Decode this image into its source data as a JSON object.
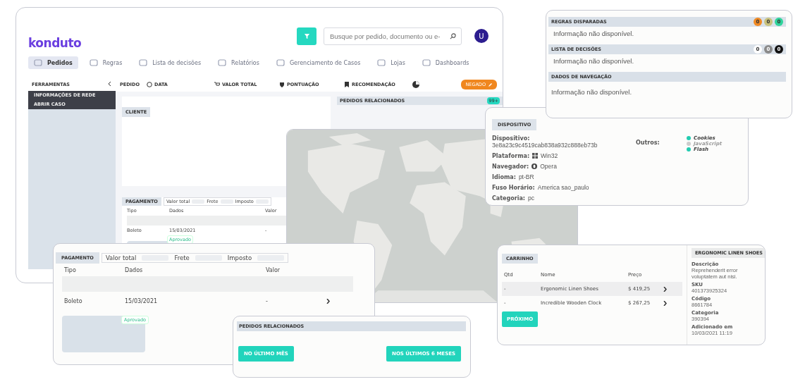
{
  "app": {
    "logo": "konduto",
    "search": {
      "placeholder": "Busque por pedido, documento ou e-"
    },
    "avatar": "U",
    "nav": [
      {
        "label": "Pedidos",
        "selected": true
      },
      {
        "label": "Regras",
        "selected": false
      },
      {
        "label": "Lista de decisões",
        "selected": false
      },
      {
        "label": "Relatórios",
        "selected": false
      },
      {
        "label": "Gerenciamento de Casos",
        "selected": false
      },
      {
        "label": "Lojas",
        "selected": false
      },
      {
        "label": "Dashboards",
        "selected": false
      }
    ],
    "sidebar": {
      "title": "FERRAMENTAS",
      "items": [
        "INFORMAÇÕES DE REDE",
        "ABRIR CASO"
      ]
    },
    "order_header": {
      "title": "PEDIDO",
      "columns": [
        "DATA",
        "VALOR TOTAL",
        "PONTUAÇÃO",
        "RECOMENDAÇÃO"
      ],
      "status": "NEGADO"
    },
    "client": {
      "title": "CLIENTE"
    },
    "related": {
      "title": "PEDIDOS RELACIONADOS",
      "count": "99+"
    },
    "payment": {
      "title": "PAGAMENTO",
      "summary": [
        "Valor total",
        "Frete",
        "Imposto"
      ],
      "columns": [
        "Tipo",
        "Dados",
        "Valor"
      ],
      "rows": [
        {
          "cells": [
            "Boleto",
            "15/03/2021",
            "-"
          ]
        }
      ],
      "status": "Aprovado"
    }
  },
  "rules_card": {
    "sections": [
      {
        "title": "REGRAS DISPARADAS",
        "badges": [
          {
            "text": "0",
            "color": "#f08a24"
          },
          {
            "text": "0",
            "color": "#c9c27c"
          },
          {
            "text": "0",
            "color": "#2fd39b"
          }
        ],
        "message": "Informação não disponível."
      },
      {
        "title": "LISTA DE DECISÕES",
        "badges": [
          {
            "text": "0",
            "color": "#ffffff"
          },
          {
            "text": "0",
            "color": "#8a8a8a"
          },
          {
            "text": "0",
            "color": "#111111"
          }
        ],
        "message": "Informação não disponível."
      },
      {
        "title": "DADOS DE NAVEGAÇÃO",
        "message": "Informação não disponível."
      }
    ]
  },
  "device_card": {
    "title": "DISPOSITIVO",
    "fields": [
      {
        "kind": "stacked",
        "label": "Dispositivo:",
        "value": "3e8a23c9c4519cab838a932c888eb73b"
      },
      {
        "kind": "windows",
        "label": "Plataforma:",
        "value": "Win32"
      },
      {
        "kind": "browser",
        "label": "Navegador:",
        "value": "Opera"
      },
      {
        "kind": "plain",
        "label": "Idioma:",
        "value": "pt-BR"
      },
      {
        "kind": "plain",
        "label": "Fuso Horário:",
        "value": "America sao_paulo"
      },
      {
        "kind": "plain",
        "label": "Categoria:",
        "value": "pc"
      }
    ],
    "others": {
      "label": "Outros:",
      "items": [
        {
          "label": "Cookies",
          "on": true
        },
        {
          "label": "JavaScript",
          "on": false
        },
        {
          "label": "Flash",
          "on": true
        }
      ]
    }
  },
  "payment_card": {
    "title": "PAGAMENTO",
    "summary": [
      "Valor total",
      "Frete",
      "Imposto"
    ],
    "columns": [
      "Tipo",
      "Dados",
      "Valor"
    ],
    "rows": [
      {
        "cells": [
          "Boleto",
          "15/03/2021",
          "-"
        ]
      }
    ],
    "status": "Aprovado"
  },
  "related_card": {
    "title": "PEDIDOS RELACIONADOS",
    "buttons": [
      "NO ÚLTIMO MÊS",
      "NOS ÚLTIMOS 6 MESES"
    ]
  },
  "cart_card": {
    "title": "CARRINHO",
    "columns": [
      "Qtd",
      "Nome",
      "Preço"
    ],
    "rows": [
      {
        "cells": [
          "-",
          "Ergonomic Linen Shoes",
          "$ 419,25"
        ],
        "selected": true
      },
      {
        "cells": [
          "-",
          "Incredible Wooden Clock",
          "$ 267,25"
        ],
        "selected": false
      }
    ],
    "button": "PRÓXIMO",
    "detail": {
      "title": "ERGONOMIC LINEN SHOES",
      "fields": [
        {
          "label": "Descrição",
          "value": "Reprehenderit error voluptatem aut nisi."
        },
        {
          "label": "SKU",
          "value": "401373925324"
        },
        {
          "label": "Código",
          "value": "8661784"
        },
        {
          "label": "Categoria",
          "value": "390394"
        },
        {
          "label": "Adicionado em",
          "value": "10/03/2021 11:19"
        }
      ]
    }
  }
}
